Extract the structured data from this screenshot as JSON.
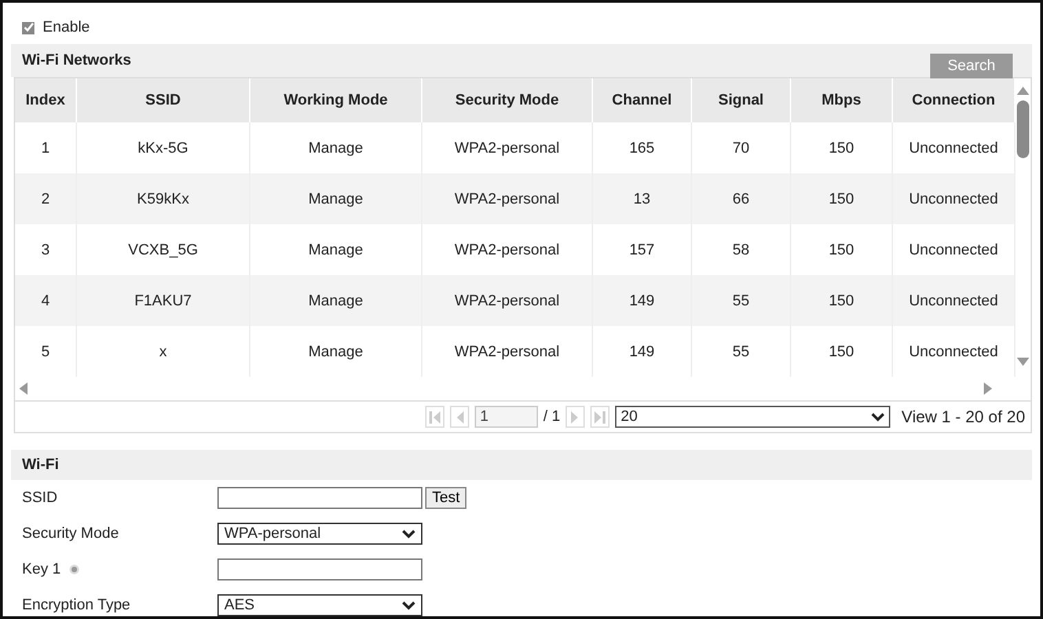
{
  "enable": {
    "label": "Enable",
    "checked": true
  },
  "networks": {
    "title": "Wi-Fi Networks",
    "search_button": "Search",
    "columns": [
      "Index",
      "SSID",
      "Working Mode",
      "Security Mode",
      "Channel",
      "Signal",
      "Mbps",
      "Connection"
    ],
    "rows": [
      [
        "1",
        "kKx-5G",
        "Manage",
        "WPA2-personal",
        "165",
        "70",
        "150",
        "Unconnected"
      ],
      [
        "2",
        "K59kKx",
        "Manage",
        "WPA2-personal",
        "13",
        "66",
        "150",
        "Unconnected"
      ],
      [
        "3",
        "VCXB_5G",
        "Manage",
        "WPA2-personal",
        "157",
        "58",
        "150",
        "Unconnected"
      ],
      [
        "4",
        "F1AKU7",
        "Manage",
        "WPA2-personal",
        "149",
        "55",
        "150",
        "Unconnected"
      ],
      [
        "5",
        "x",
        "Manage",
        "WPA2-personal",
        "149",
        "55",
        "150",
        "Unconnected"
      ]
    ]
  },
  "pager": {
    "page": "1",
    "total": "/ 1",
    "page_size": "20",
    "summary": "View 1 - 20 of 20"
  },
  "wifi": {
    "title": "Wi-Fi",
    "fields": [
      {
        "label": "SSID",
        "kind": "text",
        "button": "Test"
      },
      {
        "label": "Security Mode",
        "kind": "select",
        "value": "WPA-personal"
      },
      {
        "label": "Key 1",
        "kind": "text",
        "info_icon": true
      },
      {
        "label": "Encryption Type",
        "kind": "select",
        "value": "AES"
      }
    ]
  }
}
